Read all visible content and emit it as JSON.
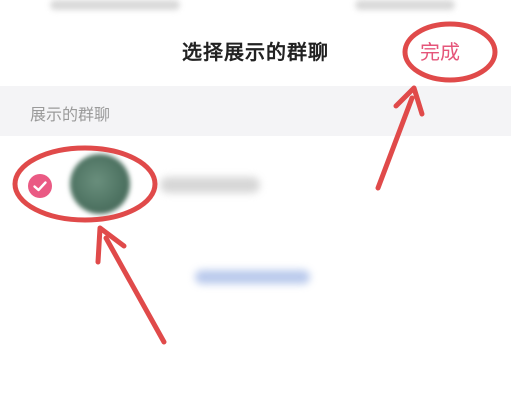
{
  "header": {
    "title": "选择展示的群聊",
    "done_label": "完成"
  },
  "section": {
    "label": "展示的群聊"
  },
  "group_list": {
    "items": [
      {
        "selected": true,
        "name_visible": false
      }
    ]
  },
  "colors": {
    "accent": "#e5557a",
    "check_fill": "#ea5a84",
    "annotation_red": "#e04a4a",
    "section_bg": "#f4f4f6",
    "title_text": "#222222"
  },
  "icons": {
    "check": "checkmark-icon"
  }
}
